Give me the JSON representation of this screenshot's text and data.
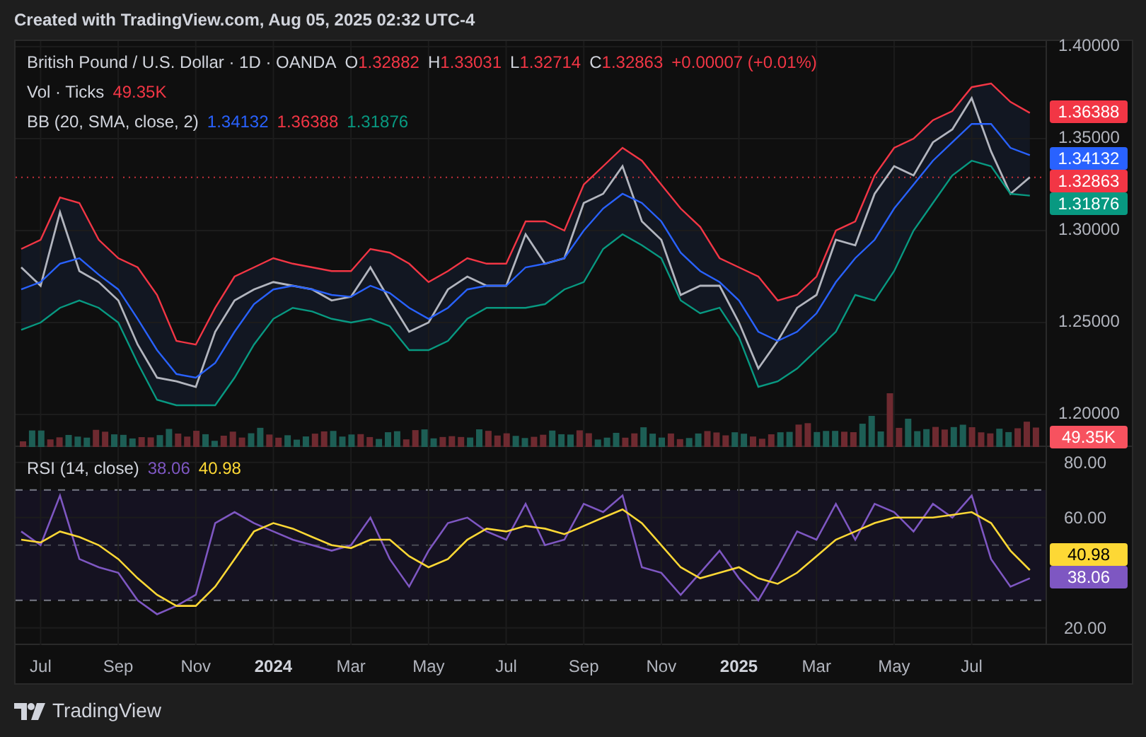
{
  "header": {
    "text": "Created with TradingView.com, Aug 05, 2025 02:32 UTC-4"
  },
  "price_pane": {
    "legend": {
      "symbol": "British Pound / U.S. Dollar · 1D · OANDA",
      "ohlc": [
        {
          "label": "O",
          "value": "1.32882"
        },
        {
          "label": "H",
          "value": "1.33031"
        },
        {
          "label": "L",
          "value": "1.32714"
        },
        {
          "label": "C",
          "value": "1.32863"
        }
      ],
      "change": "+0.00007 (+0.01%)",
      "volume_label": "Vol · Ticks",
      "volume_value": "49.35K",
      "bb_label": "BB (20, SMA, close, 2)",
      "bb_values": [
        {
          "value": "1.34132",
          "color": "#2962ff"
        },
        {
          "value": "1.36388",
          "color": "#f23645"
        },
        {
          "value": "1.31876",
          "color": "#089981"
        }
      ]
    },
    "chart_data": {
      "type": "line",
      "series": [
        {
          "color": "#b2b5be",
          "values": [
            1.28,
            1.27,
            1.31,
            1.278,
            1.272,
            1.262,
            1.238,
            1.22,
            1.218,
            1.215,
            1.245,
            1.262,
            1.268,
            1.272,
            1.27,
            1.268,
            1.262,
            1.264,
            1.28,
            1.262,
            1.245,
            1.25,
            1.268,
            1.275,
            1.27,
            1.27,
            1.298,
            1.282,
            1.285,
            1.315,
            1.32,
            1.335,
            1.305,
            1.295,
            1.265,
            1.27,
            1.27,
            1.25,
            1.225,
            1.24,
            1.258,
            1.265,
            1.295,
            1.292,
            1.32,
            1.335,
            1.33,
            1.348,
            1.355,
            1.372,
            1.343,
            1.32,
            1.329
          ]
        },
        {
          "color": "#f23645",
          "values": [
            1.29,
            1.295,
            1.318,
            1.315,
            1.295,
            1.285,
            1.28,
            1.265,
            1.24,
            1.238,
            1.258,
            1.275,
            1.28,
            1.285,
            1.282,
            1.28,
            1.278,
            1.278,
            1.29,
            1.288,
            1.282,
            1.272,
            1.278,
            1.285,
            1.282,
            1.282,
            1.305,
            1.305,
            1.3,
            1.325,
            1.335,
            1.345,
            1.338,
            1.325,
            1.312,
            1.302,
            1.285,
            1.28,
            1.275,
            1.262,
            1.265,
            1.275,
            1.3,
            1.305,
            1.33,
            1.345,
            1.35,
            1.36,
            1.365,
            1.378,
            1.38,
            1.37,
            1.364
          ]
        },
        {
          "color": "#2962ff",
          "values": [
            1.268,
            1.272,
            1.282,
            1.285,
            1.276,
            1.268,
            1.252,
            1.235,
            1.222,
            1.22,
            1.228,
            1.245,
            1.26,
            1.268,
            1.27,
            1.268,
            1.265,
            1.264,
            1.27,
            1.266,
            1.258,
            1.252,
            1.258,
            1.268,
            1.27,
            1.27,
            1.28,
            1.282,
            1.285,
            1.3,
            1.312,
            1.32,
            1.315,
            1.305,
            1.288,
            1.278,
            1.272,
            1.262,
            1.245,
            1.24,
            1.245,
            1.255,
            1.272,
            1.285,
            1.295,
            1.312,
            1.325,
            1.338,
            1.348,
            1.358,
            1.358,
            1.345,
            1.341
          ]
        },
        {
          "color": "#089981",
          "values": [
            1.246,
            1.25,
            1.258,
            1.262,
            1.258,
            1.25,
            1.228,
            1.208,
            1.205,
            1.205,
            1.205,
            1.22,
            1.238,
            1.252,
            1.258,
            1.256,
            1.252,
            1.25,
            1.252,
            1.248,
            1.235,
            1.235,
            1.24,
            1.252,
            1.258,
            1.258,
            1.258,
            1.26,
            1.268,
            1.272,
            1.29,
            1.298,
            1.292,
            1.285,
            1.262,
            1.255,
            1.258,
            1.242,
            1.215,
            1.218,
            1.225,
            1.235,
            1.245,
            1.265,
            1.262,
            1.278,
            1.3,
            1.315,
            1.33,
            1.338,
            1.335,
            1.32,
            1.319
          ]
        }
      ],
      "ylim": [
        1.1823,
        1.4031
      ],
      "yticks": [
        {
          "value": 1.4,
          "label": "1.40000"
        },
        {
          "value": 1.35,
          "label": "1.35000"
        },
        {
          "value": 1.3,
          "label": "1.30000"
        },
        {
          "value": 1.25,
          "label": "1.25000"
        },
        {
          "value": 1.2,
          "label": "1.20000"
        }
      ],
      "grid": true
    },
    "axis_badges": [
      {
        "label": "1.36388",
        "color": "#f23645"
      },
      {
        "label": "1.34132",
        "color": "#2962ff"
      },
      {
        "label": "1.32863",
        "color": "#f23645"
      },
      {
        "label": "1.31876",
        "color": "#089981"
      },
      {
        "label": "49.35K",
        "color": "#f7525f"
      }
    ]
  },
  "rsi_pane": {
    "legend": {
      "label": "RSI (14, close)",
      "values": [
        {
          "value": "38.06",
          "color": "#7e57c2"
        },
        {
          "value": "40.98",
          "color": "#fdd835"
        }
      ]
    },
    "chart_data": {
      "type": "line",
      "categories": [
        null,
        "Jul",
        null,
        null,
        null,
        "Sep",
        null,
        null,
        null,
        "Nov",
        null,
        null,
        null,
        "2024",
        null,
        null,
        null,
        "Mar",
        null,
        null,
        null,
        "May",
        null,
        null,
        null,
        "Jul",
        null,
        null,
        null,
        "Sep",
        null,
        null,
        null,
        "Nov",
        null,
        null,
        null,
        "2025",
        null,
        null,
        null,
        "Mar",
        null,
        null,
        null,
        "May",
        null,
        null,
        null,
        "Jul",
        null,
        null,
        null
      ],
      "series": [
        {
          "color": "#7e57c2",
          "values": [
            55,
            50,
            68,
            45,
            42,
            40,
            30,
            25,
            28,
            32,
            58,
            62,
            58,
            55,
            52,
            50,
            48,
            50,
            60,
            45,
            35,
            48,
            58,
            60,
            55,
            52,
            65,
            50,
            52,
            65,
            62,
            68,
            42,
            40,
            32,
            40,
            48,
            38,
            30,
            42,
            55,
            52,
            65,
            52,
            65,
            62,
            55,
            65,
            60,
            68,
            45,
            35,
            38
          ]
        },
        {
          "color": "#fdd835",
          "values": [
            52,
            51,
            55,
            53,
            50,
            45,
            38,
            32,
            28,
            28,
            35,
            45,
            55,
            58,
            56,
            53,
            50,
            49,
            52,
            52,
            46,
            42,
            45,
            52,
            56,
            55,
            57,
            56,
            54,
            57,
            60,
            63,
            58,
            50,
            42,
            38,
            40,
            42,
            38,
            36,
            40,
            46,
            52,
            55,
            58,
            60,
            60,
            60,
            61,
            62,
            58,
            48,
            41
          ]
        }
      ],
      "ylim": [
        13.8,
        85.6
      ],
      "grid": true,
      "yticks": [
        {
          "value": 80,
          "label": "80.00"
        },
        {
          "value": 60,
          "label": "60.00"
        },
        {
          "value": 20,
          "label": "20.00"
        }
      ]
    },
    "axis_badges": [
      {
        "label": "40.98",
        "color": "#fdd835"
      },
      {
        "label": "38.06",
        "color": "#7e57c2"
      }
    ]
  },
  "footer": {
    "brand": "TradingView"
  }
}
